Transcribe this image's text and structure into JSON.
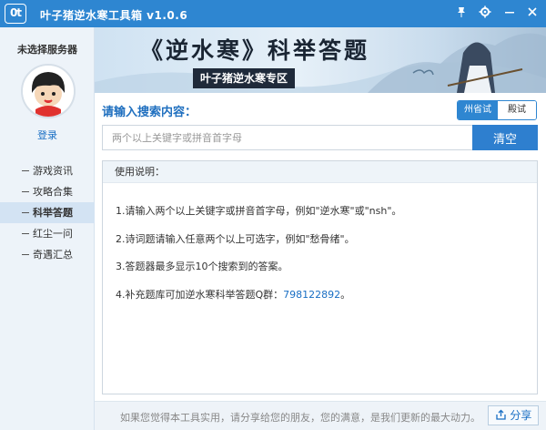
{
  "window": {
    "logo_text": "0t",
    "title": "叶子猪逆水寒工具箱 v1.0.6",
    "controls": {
      "pin_icon": "pin-icon",
      "settings_icon": "gear-icon",
      "minimize_icon": "minimize-icon",
      "close_icon": "close-icon"
    }
  },
  "sidebar": {
    "server_label": "未选择服务器",
    "login_label": "登录",
    "nav_items": [
      {
        "label": "游戏资讯",
        "active": false
      },
      {
        "label": "攻略合集",
        "active": false
      },
      {
        "label": "科举答题",
        "active": true
      },
      {
        "label": "红尘一问",
        "active": false
      },
      {
        "label": "奇遇汇总",
        "active": false
      }
    ]
  },
  "banner": {
    "title": "《逆水寒》科举答题",
    "subtitle": "叶子猪逆水寒专区"
  },
  "search": {
    "label": "请输入搜索内容：",
    "placeholder": "两个以上关键字或拼音首字母",
    "value": "",
    "clear_label": "清空",
    "modes": [
      {
        "label": "州省试",
        "active": true
      },
      {
        "label": "殿试",
        "active": false
      }
    ]
  },
  "usage": {
    "header": "使用说明：",
    "lines": [
      "1.请输入两个以上关键字或拼音首字母，例如\"逆水寒\"或\"nsh\"。",
      "2.诗词题请输入任意两个以上可选字，例如\"愁骨绪\"。",
      "3.答题器最多显示10个搜索到的答案。"
    ],
    "qq_prefix": "4.补充题库可加逆水寒科举答题Q群：",
    "qq_number": "798122892",
    "qq_suffix": "。"
  },
  "footer": {
    "message": "如果您觉得本工具实用，请分享给您的朋友，您的满意，是我们更新的最大动力。",
    "share_label": "分享",
    "share_icon": "share-icon"
  },
  "colors": {
    "accent": "#2e86d1",
    "sidebar_bg": "#edf3f9",
    "link": "#1a6fc4"
  }
}
